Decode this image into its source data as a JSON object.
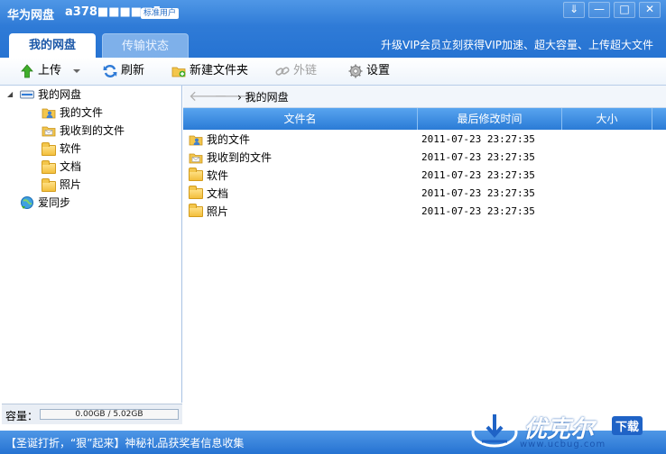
{
  "window": {
    "app_title": "华为网盘",
    "user_id": "a378■■■■■5",
    "user_badge": "标准用户",
    "controls": [
      "⇓",
      "—",
      "□",
      "✕"
    ]
  },
  "tabs": [
    {
      "label": "我的网盘",
      "active": true
    },
    {
      "label": "传输状态",
      "active": false
    }
  ],
  "promo_text": "升级VIP会员立刻获得VIP加速、超大容量、上传超大文件",
  "toolbar": {
    "upload": "上传",
    "refresh": "刷新",
    "new_folder": "新建文件夹",
    "external_link": "外链",
    "settings": "设置"
  },
  "tree": {
    "root": "我的网盘",
    "children": [
      "我的文件",
      "我收到的文件",
      "软件",
      "文档",
      "照片"
    ],
    "sync": "爱同步"
  },
  "capacity": {
    "label": "容量：",
    "text": "0.00GB / 5.02GB",
    "used_fraction": 0.0
  },
  "breadcrumb": "我的网盘",
  "columns": {
    "name": "文件名",
    "modified": "最后修改时间",
    "size": "大小"
  },
  "files": [
    {
      "name": "我的文件",
      "modified": "2011-07-23 23:27:35",
      "size": ""
    },
    {
      "name": "我收到的文件",
      "modified": "2011-07-23 23:27:35",
      "size": ""
    },
    {
      "name": "软件",
      "modified": "2011-07-23 23:27:35",
      "size": ""
    },
    {
      "name": "文档",
      "modified": "2011-07-23 23:27:35",
      "size": ""
    },
    {
      "name": "照片",
      "modified": "2011-07-23 23:27:35",
      "size": ""
    }
  ],
  "status_text": "【圣诞打折，“狠”起来】神秘礼品获奖者信息收集",
  "watermark": {
    "logo": "优克尔",
    "download": "下载",
    "url": "www.ucbug.com"
  }
}
